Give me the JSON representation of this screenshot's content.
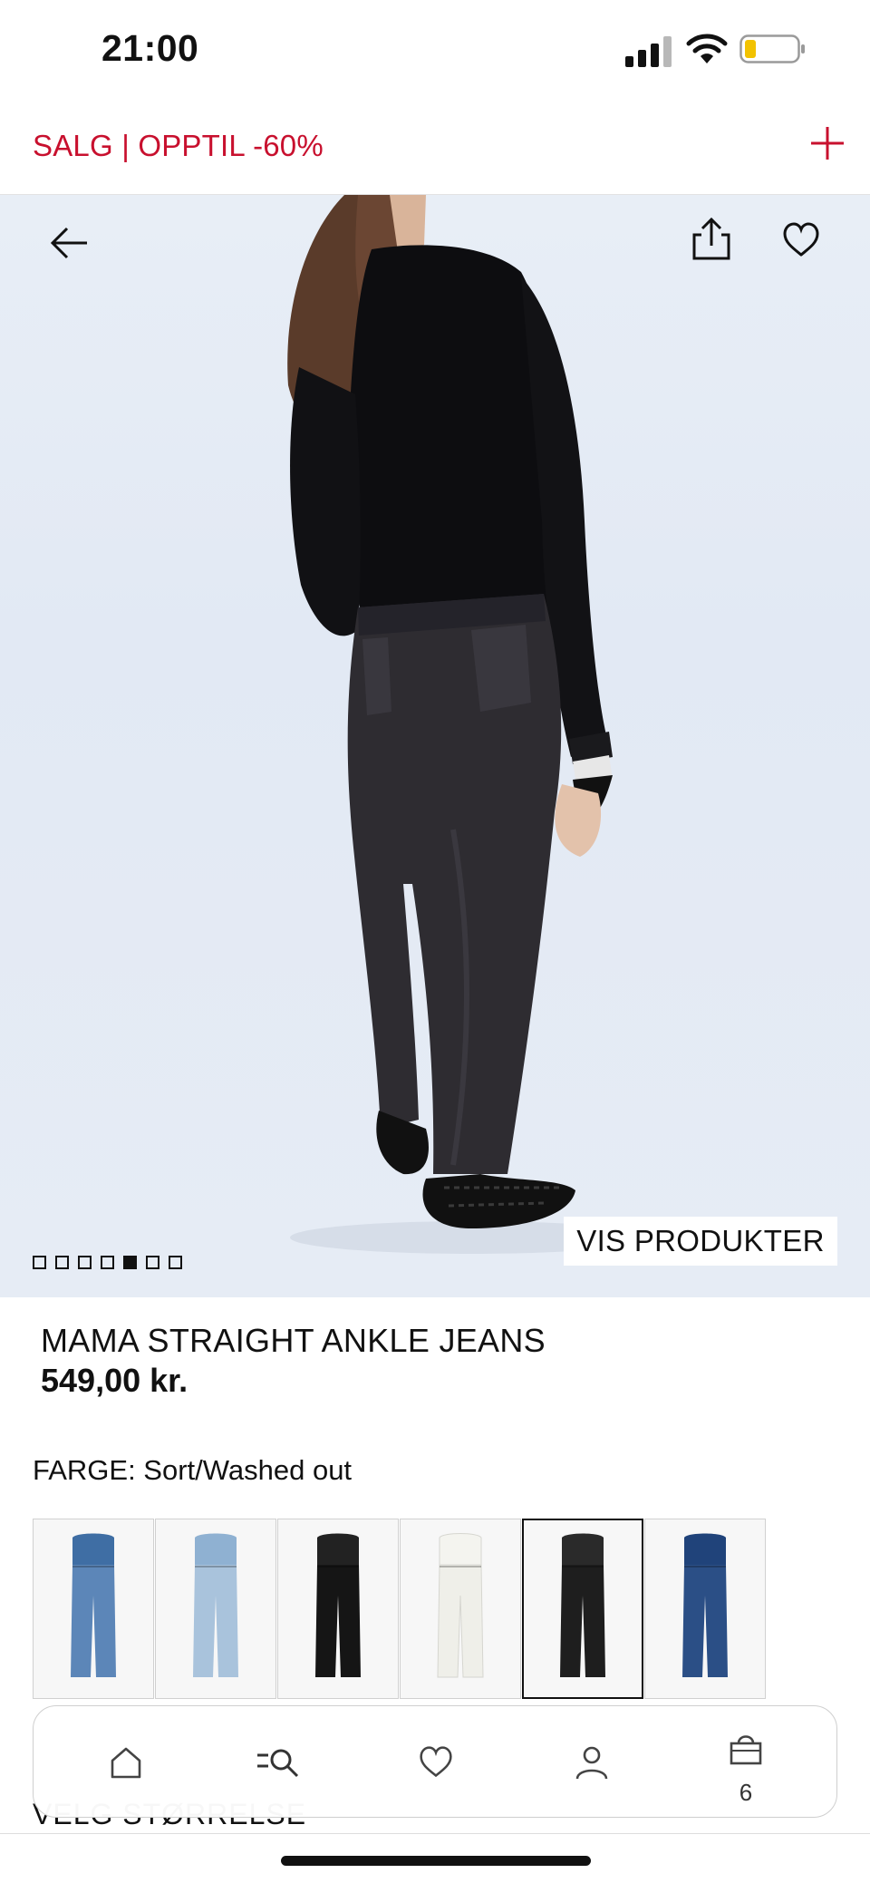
{
  "status": {
    "time": "21:00"
  },
  "promo": {
    "text": "SALG | OPPTIL -60%"
  },
  "hero": {
    "image_count": 7,
    "active_image": 5,
    "view_products_label": "VIS PRODUKTER"
  },
  "product": {
    "name": "MAMA STRAIGHT ANKLE JEANS",
    "price": "549,00 kr.",
    "color_label": "FARGE: Sort/Washed out"
  },
  "swatches": [
    {
      "name": "light-blue-denim",
      "color": "#5c86b8",
      "belly": "#3f6ea4"
    },
    {
      "name": "pale-blue-denim",
      "color": "#a9c3dc",
      "belly": "#8fb1d2"
    },
    {
      "name": "black",
      "color": "#151515",
      "belly": "#222222"
    },
    {
      "name": "white",
      "color": "#efefe9",
      "belly": "#f4f4ef"
    },
    {
      "name": "black-washed-out",
      "color": "#1e1e1e",
      "belly": "#2a2a2a",
      "selected": true
    },
    {
      "name": "dark-blue-denim",
      "color": "#2b4f86",
      "belly": "#20437a"
    }
  ],
  "size_label": "VELG STØRRELSE",
  "nav": {
    "items": [
      "home-icon",
      "search-icon",
      "heart-icon",
      "profile-icon",
      "bag-icon"
    ],
    "cart_count": "6"
  },
  "colors": {
    "accent_red": "#c8102e",
    "hero_bg": "#e6ecf5"
  }
}
